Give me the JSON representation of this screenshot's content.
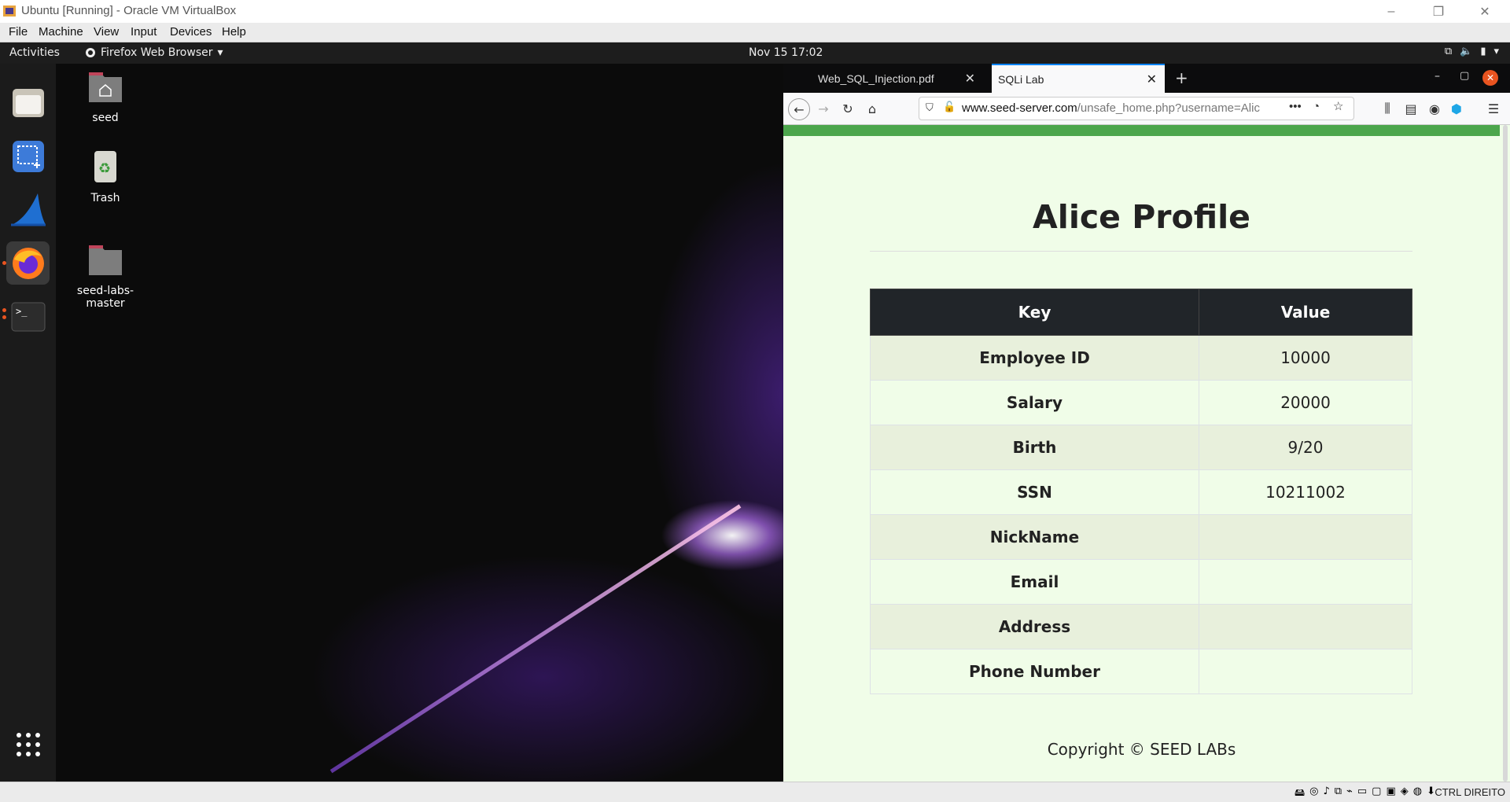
{
  "vbox": {
    "title": "Ubuntu [Running] - Oracle VM VirtualBox",
    "menu": [
      "File",
      "Machine",
      "View",
      "Input",
      "Devices",
      "Help"
    ],
    "host_key": "CTRL DIREITO"
  },
  "gnome": {
    "activities": "Activities",
    "app_menu": "Firefox Web Browser",
    "clock": "Nov 15  17:02"
  },
  "desktop": {
    "icons": [
      {
        "label": "seed",
        "icon": "home-folder-icon"
      },
      {
        "label": "Trash",
        "icon": "trash-icon"
      },
      {
        "label": "seed-labs-\nmaster",
        "icon": "folder-icon"
      }
    ]
  },
  "dock": {
    "items": [
      "files-icon",
      "screenshot-icon",
      "wireshark-icon",
      "firefox-icon",
      "terminal-icon",
      "show-apps-icon"
    ]
  },
  "firefox": {
    "tabs": [
      {
        "label": "Web_SQL_Injection.pdf",
        "active": false
      },
      {
        "label": "SQLi Lab",
        "active": true
      }
    ],
    "url_host": "www.seed-server.com",
    "url_path": "/unsafe_home.php?username=Alic"
  },
  "page": {
    "title": "Alice Profile",
    "table": {
      "headers": [
        "Key",
        "Value"
      ],
      "rows": [
        {
          "key": "Employee ID",
          "value": "10000"
        },
        {
          "key": "Salary",
          "value": "20000"
        },
        {
          "key": "Birth",
          "value": "9/20"
        },
        {
          "key": "SSN",
          "value": "10211002"
        },
        {
          "key": "NickName",
          "value": ""
        },
        {
          "key": "Email",
          "value": ""
        },
        {
          "key": "Address",
          "value": ""
        },
        {
          "key": "Phone Number",
          "value": ""
        }
      ]
    },
    "copyright": "Copyright © SEED LABs"
  },
  "colors": {
    "accent_green": "#4ca64c",
    "page_bg": "#f0fde8",
    "table_header": "#212529",
    "ubuntu_orange": "#e95420"
  }
}
